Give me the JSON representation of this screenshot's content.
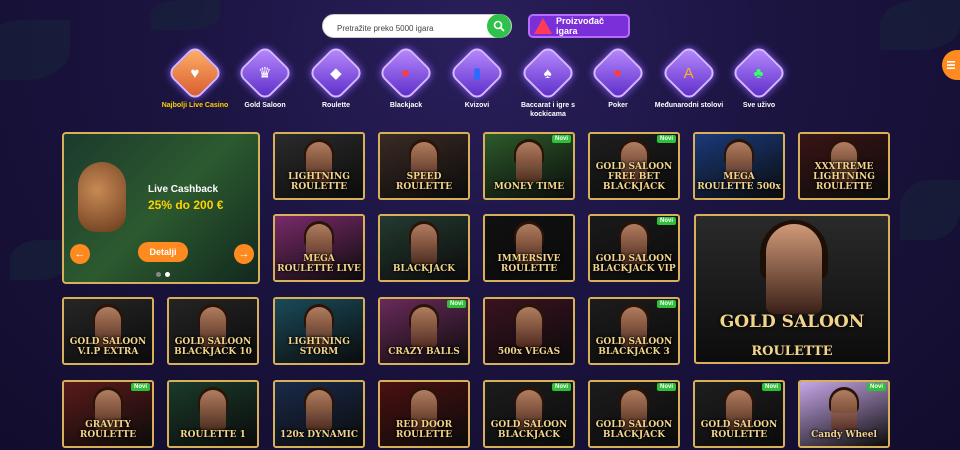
{
  "search": {
    "placeholder": "Pretražite preko 5000 igara"
  },
  "provider_button": {
    "label": "Proizvođač igara"
  },
  "categories": [
    {
      "label": "Najbolji Live Casino",
      "icon": "heart-icon"
    },
    {
      "label": "Gold Saloon",
      "icon": "crown-icon"
    },
    {
      "label": "Roulette",
      "icon": "gem-icon"
    },
    {
      "label": "Blackjack",
      "icon": "chips-icon"
    },
    {
      "label": "Kvizovi",
      "icon": "top-hat-icon"
    },
    {
      "label": "Baccarat i igre s kockicama",
      "icon": "spade-card-icon"
    },
    {
      "label": "Poker",
      "icon": "poker-chips-icon"
    },
    {
      "label": "Međunarodni stolovi",
      "icon": "globe-icon"
    },
    {
      "label": "Sve uživo",
      "icon": "club-card-icon"
    }
  ],
  "promo": {
    "title": "Live Cashback",
    "value": "25% do 200 €",
    "button": "Detalji",
    "prev": "←",
    "next": "→"
  },
  "new_badge": "Novi",
  "tiles": [
    {
      "title": "LIGHTNING ROULETTE",
      "new": false,
      "bg": "#2b2b2b"
    },
    {
      "title": "SPEED ROULETTE",
      "new": false,
      "bg": "#3a2a24"
    },
    {
      "title": "MONEY TIME",
      "new": true,
      "bg": "#2d5a2a"
    },
    {
      "title": "GOLD SALOON FREE BET BLACKJACK",
      "new": true,
      "bg": "#1e1e1e"
    },
    {
      "title": "MEGA ROULETTE 500x",
      "new": false,
      "bg": "#1a3a7a"
    },
    {
      "title": "XXXTREME LIGHTNING ROULETTE",
      "new": false,
      "bg": "#3a1414"
    },
    {
      "title": "MEGA ROULETTE LIVE",
      "new": false,
      "bg": "#7a2a6a"
    },
    {
      "title": "BLACKJACK",
      "new": false,
      "bg": "#243a30"
    },
    {
      "title": "IMMERSIVE ROULETTE",
      "new": false,
      "bg": "#101010"
    },
    {
      "title": "GOLD SALOON BLACKJACK VIP",
      "new": true,
      "bg": "#1a1a1a"
    },
    {
      "title": "GOLD SALOON V.I.P EXTRA",
      "new": false,
      "bg": "#262626"
    },
    {
      "title": "GOLD SALOON BLACKJACK 10",
      "new": false,
      "bg": "#242424"
    },
    {
      "title": "LIGHTNING STORM",
      "new": false,
      "bg": "#1a4a5a"
    },
    {
      "title": "CRAZY BALLS",
      "new": true,
      "bg": "#6a2a5a"
    },
    {
      "title": "500x VEGAS",
      "new": false,
      "bg": "#3a1220"
    },
    {
      "title": "GOLD SALOON BLACKJACK 3",
      "new": true,
      "bg": "#1c1c1c"
    },
    {
      "title": "GRAVITY ROULETTE",
      "new": true,
      "bg": "#5a1a1a"
    },
    {
      "title": "ROULETTE 1",
      "new": false,
      "bg": "#1a3a2a"
    },
    {
      "title": "120x DYNAMIC",
      "new": false,
      "bg": "#1a2a4a"
    },
    {
      "title": "RED DOOR ROULETTE",
      "new": false,
      "bg": "#4a1010"
    },
    {
      "title": "GOLD SALOON BLACKJACK",
      "new": true,
      "bg": "#1c1c1c"
    },
    {
      "title": "GOLD SALOON BLACKJACK",
      "new": true,
      "bg": "#1c1c1c"
    },
    {
      "title": "GOLD SALOON ROULETTE",
      "new": true,
      "bg": "#1e1e1e"
    },
    {
      "title": "Candy Wheel",
      "new": true,
      "bg": "#c6a6e8"
    }
  ],
  "big_tile": {
    "title1": "GOLD SALOON",
    "title2": "ROULETTE",
    "new": false
  }
}
